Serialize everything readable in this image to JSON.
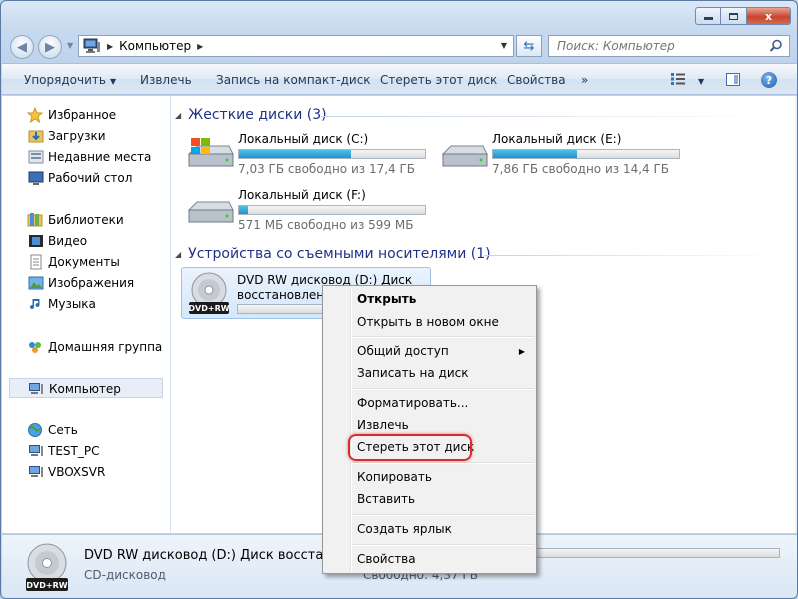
{
  "window": {
    "min_label": "",
    "max_label": "",
    "close_label": "x"
  },
  "address": {
    "location": "Компьютер",
    "search_placeholder": "Поиск: Компьютер"
  },
  "toolbar": {
    "organize": "Упорядочить",
    "eject": "Извлечь",
    "burn": "Запись на компакт-диск",
    "erase": "Стереть этот диск",
    "properties": "Свойства",
    "more": "»",
    "help": "?"
  },
  "nav": {
    "favorites": "Избранное",
    "downloads": "Загрузки",
    "recent": "Недавние места",
    "desktop": "Рабочий стол",
    "libraries": "Библиотеки",
    "video": "Видео",
    "documents": "Документы",
    "pictures": "Изображения",
    "music": "Музыка",
    "homegroup": "Домашняя группа",
    "computer": "Компьютер",
    "network": "Сеть",
    "test_pc": "TEST_PC",
    "vboxsvr": "VBOXSVR"
  },
  "groups": {
    "hard_disks": "Жесткие диски (3)",
    "removable": "Устройства со съемными носителями (1)"
  },
  "drives": [
    {
      "name": "Локальный диск (C:)",
      "free": "7,03 ГБ свободно из 17,4 ГБ",
      "used_fraction": 0.6
    },
    {
      "name": "Локальный диск (E:)",
      "free": "7,86 ГБ свободно из 14,4 ГБ",
      "used_fraction": 0.45
    },
    {
      "name": "Локальный диск (F:)",
      "free": "571 МБ свободно из 599 МБ",
      "used_fraction": 0.05
    }
  ],
  "dvd": {
    "name_line1": "DVD RW дисковод (D:) Диск",
    "name_line2": "восстановлени",
    "badge": "DVD+RW"
  },
  "context_menu": {
    "open": "Открыть",
    "open_new_window": "Открыть в новом окне",
    "share": "Общий доступ",
    "burn": "Записать на диск",
    "format": "Форматировать...",
    "eject": "Извлечь",
    "erase": "Стереть этот диск",
    "copy": "Копировать",
    "paste": "Вставить",
    "shortcut": "Создать ярлык",
    "properties": "Свойства"
  },
  "details": {
    "name": "DVD RW дисковод (D:) Диск восстановл",
    "type": "CD-дисковод",
    "free": "Свободно: 4,37 ГБ",
    "badge": "DVD+RW"
  },
  "colors": {
    "accent": "#1e3287",
    "highlight_ring": "#d32f2f",
    "bar_fill": "#2392c8"
  }
}
